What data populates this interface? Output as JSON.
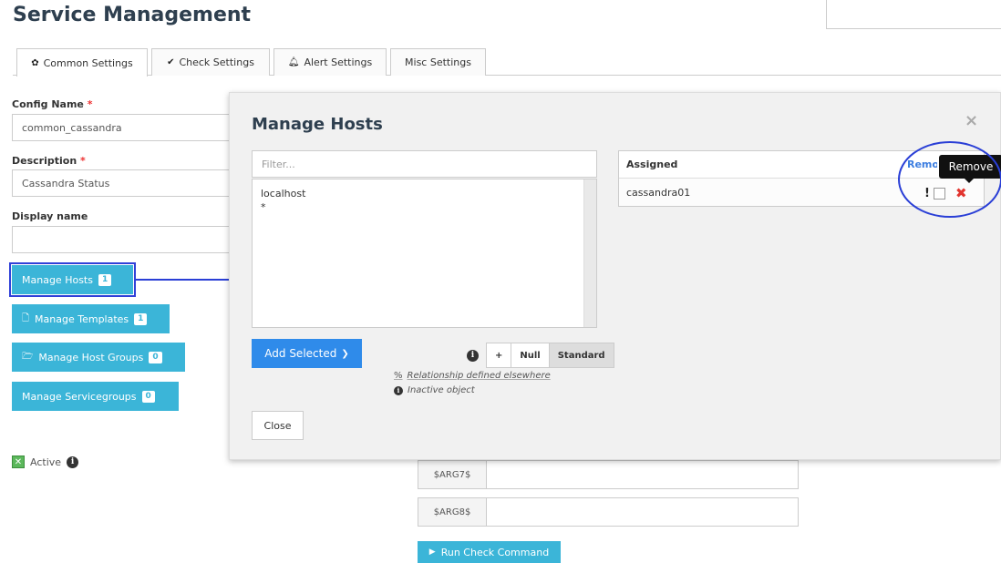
{
  "page": {
    "title": "Service Management"
  },
  "tabs": [
    {
      "label": "Common Settings",
      "icon": "gear-icon"
    },
    {
      "label": "Check Settings",
      "icon": "check-icon"
    },
    {
      "label": "Alert Settings",
      "icon": "bell-icon"
    },
    {
      "label": "Misc Settings",
      "icon": ""
    }
  ],
  "form": {
    "config_name_label": "Config Name",
    "config_name_value": "common_cassandra",
    "description_label": "Description",
    "description_value": "Cassandra Status",
    "display_name_label": "Display name",
    "display_name_value": "",
    "required_marker": "*"
  },
  "side_buttons": {
    "manage_hosts": {
      "label": "Manage Hosts",
      "count": "1"
    },
    "manage_templates": {
      "label": "Manage Templates",
      "count": "1"
    },
    "manage_host_groups": {
      "label": "Manage Host Groups",
      "count": "0"
    },
    "manage_servicegroups": {
      "label": "Manage Servicegroups",
      "count": "0"
    }
  },
  "active": {
    "label": "Active",
    "checked": true
  },
  "args": [
    {
      "label": "$ARG7$",
      "value": ""
    },
    {
      "label": "$ARG8$",
      "value": ""
    }
  ],
  "run_button": {
    "label": "Run Check Command"
  },
  "modal": {
    "title": "Manage Hosts",
    "close_icon": "×",
    "filter_placeholder": "Filter...",
    "available_hosts": [
      "localhost",
      "*"
    ],
    "add_selected_label": "Add Selected",
    "add_selected_chevron": "❯",
    "segment_info": "i",
    "segment_options": [
      "+",
      "Null",
      "Standard"
    ],
    "segment_selected": "Standard",
    "legend": [
      {
        "icon": "%",
        "text": "Relationship defined elsewhere"
      },
      {
        "icon": "i",
        "text": "Inactive object"
      }
    ],
    "close_button": "Close",
    "assigned_header": "Assigned",
    "remove_all_link": "Remove All",
    "assigned_rows": [
      {
        "name": "cassandra01",
        "exclude_marker": "!"
      }
    ],
    "tooltip": "Remove"
  },
  "colors": {
    "primary_button": "#3bb5d8",
    "add_button": "#2f8bea",
    "remove_icon": "#e2352f",
    "annotation": "#2a3fd6"
  }
}
